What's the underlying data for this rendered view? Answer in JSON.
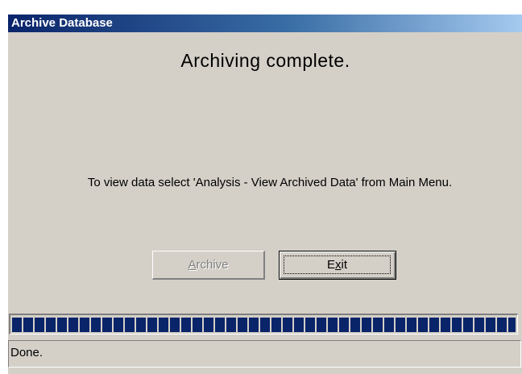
{
  "window": {
    "title": "Archive Database"
  },
  "main": {
    "heading": "Archiving complete.",
    "instruction": "To view data select 'Analysis - View Archived Data' from Main Menu."
  },
  "buttons": {
    "archive": {
      "mnemonic": "A",
      "rest": "rchive",
      "enabled": false
    },
    "exit": {
      "pre": "E",
      "mnemonic": "x",
      "post": "it",
      "focused": true
    }
  },
  "progress": {
    "percent": 100,
    "color": "#0a246a"
  },
  "status": {
    "text": "Done."
  },
  "colors": {
    "title_bar_start": "#0a246a",
    "title_bar_end": "#a6caf0",
    "face": "#d4d0c8"
  }
}
